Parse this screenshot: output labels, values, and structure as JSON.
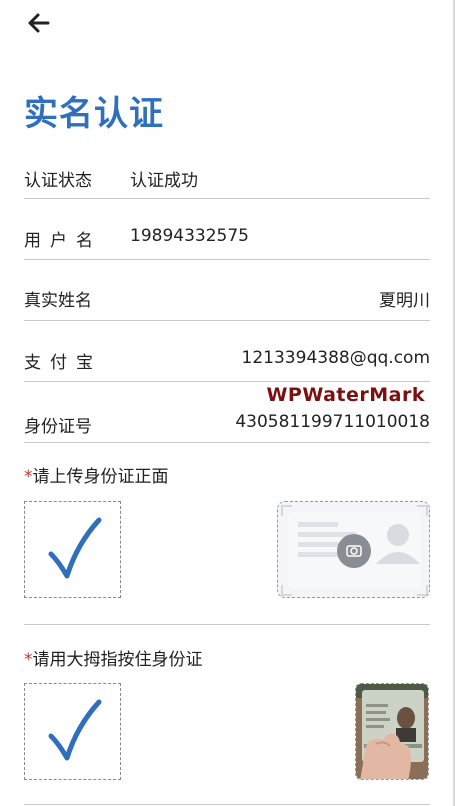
{
  "header": {
    "back_icon": "arrow-left-icon",
    "title": "实名认证"
  },
  "fields": {
    "status": {
      "label": "认证状态",
      "value": "认证成功"
    },
    "username": {
      "label": "用户名",
      "value": "19894332575"
    },
    "real_name": {
      "label": "真实姓名",
      "value": "夏明川"
    },
    "alipay": {
      "label": "支付宝",
      "value": "1213394388@qq.com"
    },
    "id_number": {
      "label": "身份证号",
      "value": "430581199711010018"
    }
  },
  "watermark": "WPWaterMark",
  "upload_front": {
    "required_mark": "*",
    "label": "请上传身份证正面",
    "status_icon": "checkmark-icon",
    "sample_icon": "id-card-camera-icon"
  },
  "upload_hold": {
    "required_mark": "*",
    "label": "请用大拇指按住身份证",
    "status_icon": "checkmark-icon",
    "thumbnail": "id-card-photo"
  },
  "colors": {
    "title": "#2f6fbc",
    "check": "#2f6fbc",
    "required": "#c0392b",
    "watermark": "#7a1010",
    "divider": "#c8c8c8"
  }
}
